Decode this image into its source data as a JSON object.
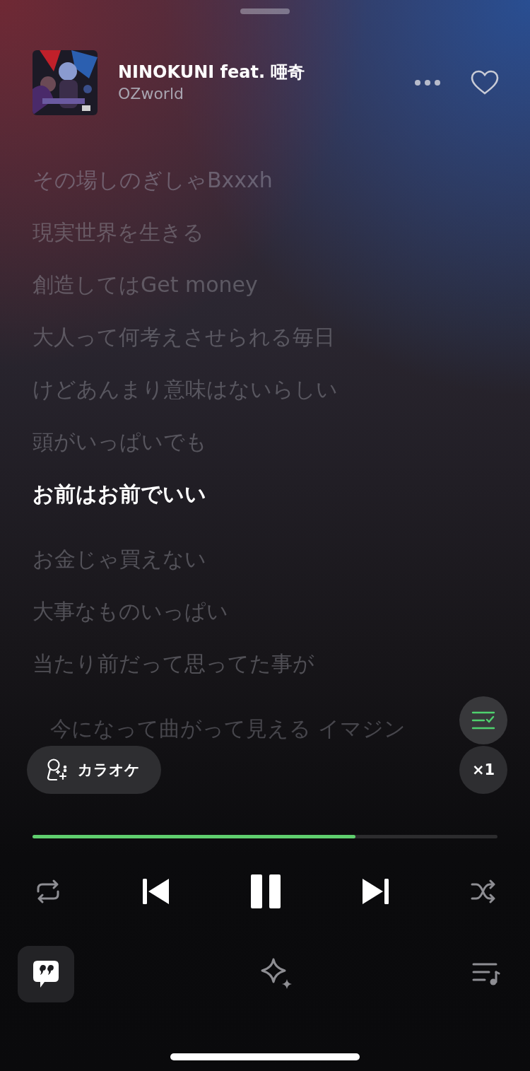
{
  "track": {
    "title": "NINOKUNI feat. 唖奇",
    "artist": "OZworld",
    "liked": false
  },
  "lyrics": [
    {
      "text": "その場しのぎしゃBxxxh",
      "selected": false
    },
    {
      "text": "現実世界を生きる",
      "selected": false
    },
    {
      "text": "創造してはGet money",
      "selected": false
    },
    {
      "text": "大人って何考えさせられる毎日",
      "selected": false
    },
    {
      "text": "けどあんまり意味はないらしい",
      "selected": false
    },
    {
      "text": "頭がいっぱいでも",
      "selected": false
    },
    {
      "text": "お前はお前でいい",
      "selected": true
    },
    {
      "text": "お金じゃ買えない",
      "selected": false
    },
    {
      "text": "大事なものいっぱい",
      "selected": false
    },
    {
      "text": "当たり前だって思ってた事が",
      "selected": false
    },
    {
      "text": "今になって曲がって見える イマジン",
      "selected": false
    }
  ],
  "karaoke": {
    "label": "カラオケ"
  },
  "speed": {
    "label": "×1"
  },
  "progress": {
    "level": 0.694
  },
  "playback": {
    "playing": true
  }
}
